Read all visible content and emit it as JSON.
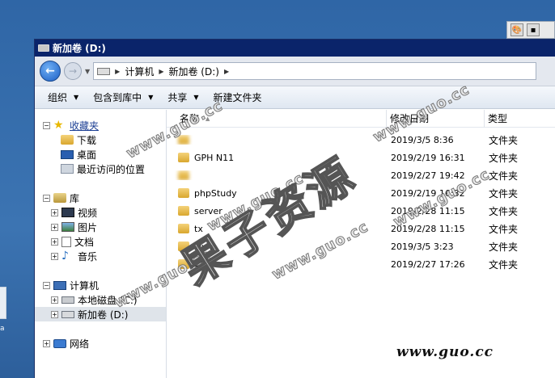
{
  "window": {
    "title": "新加卷 (D:)"
  },
  "address": {
    "crumbs": [
      "计算机",
      "新加卷 (D:)"
    ]
  },
  "commands": {
    "organize": "组织",
    "include_library": "包含到库中",
    "share": "共享",
    "new_folder": "新建文件夹"
  },
  "nav": {
    "favorites": "收藏夹",
    "favorites_items": [
      "下载",
      "桌面",
      "最近访问的位置"
    ],
    "libraries": "库",
    "library_items": [
      "视频",
      "图片",
      "文档",
      "音乐"
    ],
    "computer": "计算机",
    "drives": [
      "本地磁盘 (C:)",
      "新加卷 (D:)"
    ],
    "network": "网络"
  },
  "columns": {
    "name": "名称",
    "date": "修改日期",
    "type": "类型"
  },
  "files": [
    {
      "name": "",
      "date": "2019/3/5 8:36",
      "type": "文件夹"
    },
    {
      "name": "GPH N11",
      "date": "2019/2/19 16:31",
      "type": "文件夹"
    },
    {
      "name": "",
      "date": "2019/2/27 19:42",
      "type": "文件夹"
    },
    {
      "name": "phpStudy",
      "date": "2019/2/19 16:32",
      "type": "文件夹"
    },
    {
      "name": "server",
      "date": "2019/2/28 11:15",
      "type": "文件夹"
    },
    {
      "name": "tx",
      "date": "2019/2/28 11:15",
      "type": "文件夹"
    },
    {
      "name": "www",
      "date": "2019/3/5 3:23",
      "type": "文件夹"
    },
    {
      "name": "软件",
      "date": "2019/2/27 17:26",
      "type": "文件夹"
    }
  ],
  "watermarks": {
    "main": "果子资源",
    "url": "www.guo.cc",
    "corner": "www.guo.cc"
  },
  "desktop": {
    "icon_label": "a"
  }
}
